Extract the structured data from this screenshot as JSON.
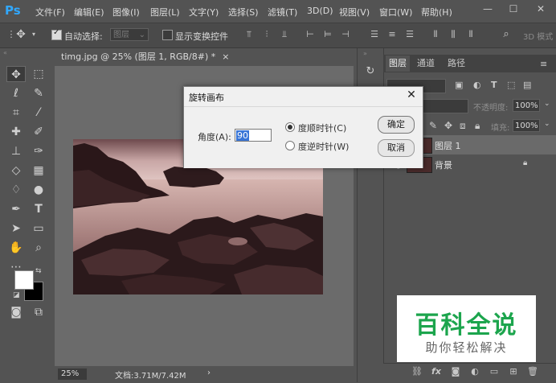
{
  "app": {
    "logo": "Ps"
  },
  "menu": [
    "文件(F)",
    "编辑(E)",
    "图像(I)",
    "图层(L)",
    "文字(Y)",
    "选择(S)",
    "滤镜(T)",
    "3D(D)",
    "视图(V)",
    "窗口(W)",
    "帮助(H)"
  ],
  "window_controls": {
    "minimize": "—",
    "maximize": "☐",
    "close": "✕"
  },
  "options": {
    "auto_select_label": "自动选择:",
    "auto_select_checked": true,
    "auto_select_target": "图层",
    "show_transform_label": "显示变换控件",
    "mode_3d": "3D 模式"
  },
  "document": {
    "tab_title": "timg.jpg @ 25% (图层 1, RGB/8#) *",
    "zoom": "25%",
    "info": "文档:3.71M/7.42M"
  },
  "layers_panel": {
    "tabs": [
      "图层",
      "通道",
      "路径"
    ],
    "opacity_label": "不透明度:",
    "opacity_value": "100%",
    "fill_label": "填充:",
    "fill_value": "100%",
    "layers": [
      {
        "name": "图层 1",
        "selected": true
      },
      {
        "name": "背景",
        "locked": true
      }
    ]
  },
  "dialog": {
    "title": "旋转画布",
    "angle_label": "角度(A):",
    "angle_value": "90",
    "cw_label": "度顺时针(C)",
    "ccw_label": "度逆时针(W)",
    "cw_selected": true,
    "ok_label": "确定",
    "cancel_label": "取消"
  },
  "watermark": {
    "title": "百科全说",
    "subtitle": "助你轻松解决"
  },
  "colors": {
    "accent": "#31a8ff",
    "selection": "#3875d7",
    "watermark_green": "#1ca54d"
  }
}
